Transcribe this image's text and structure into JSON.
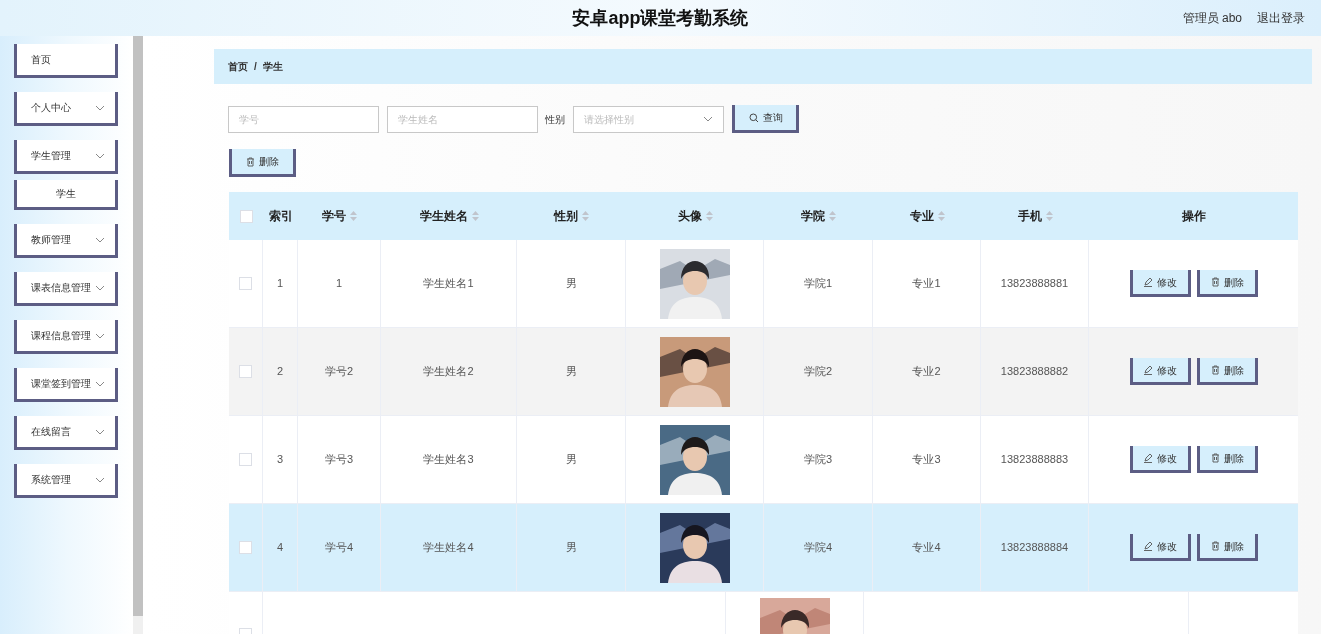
{
  "header": {
    "title": "安卓app课堂考勤系统",
    "user": "管理员 abo",
    "logout": "退出登录"
  },
  "sidebar": {
    "items": [
      {
        "label": "首页",
        "kind": "link"
      },
      {
        "label": "个人中心",
        "kind": "group"
      },
      {
        "label": "学生管理",
        "kind": "group",
        "children": [
          {
            "label": "学生"
          }
        ]
      },
      {
        "label": "教师管理",
        "kind": "group"
      },
      {
        "label": "课表信息管理",
        "kind": "group"
      },
      {
        "label": "课程信息管理",
        "kind": "group"
      },
      {
        "label": "课堂签到管理",
        "kind": "group"
      },
      {
        "label": "在线留言",
        "kind": "group"
      },
      {
        "label": "系统管理",
        "kind": "group"
      }
    ]
  },
  "breadcrumb": [
    "首页",
    "/",
    "学生"
  ],
  "search": {
    "student_no": {
      "placeholder": "学号"
    },
    "student_name": {
      "placeholder": "学生姓名"
    },
    "gender_label": "性别",
    "gender": {
      "placeholder": "请选择性别"
    },
    "query_button": "查询"
  },
  "delete_button": "删除",
  "table": {
    "select_all": {
      "checked": false
    },
    "columns": [
      {
        "label": "索引",
        "sortable": false
      },
      {
        "label": "学号",
        "sortable": true
      },
      {
        "label": "学生姓名",
        "sortable": true
      },
      {
        "label": "性别",
        "sortable": true
      },
      {
        "label": "头像",
        "sortable": true
      },
      {
        "label": "学院",
        "sortable": true
      },
      {
        "label": "专业",
        "sortable": true
      },
      {
        "label": "手机",
        "sortable": true
      },
      {
        "label": "操作",
        "sortable": false
      }
    ],
    "rows": [
      {
        "checked": false,
        "hovered": false,
        "selected": false,
        "cells": [
          "1",
          "1",
          "学生姓名1",
          "男",
          "",
          "学院1",
          "专业1",
          "13823888881"
        ],
        "actions": [
          "修改",
          "删除"
        ]
      },
      {
        "checked": false,
        "hovered": true,
        "selected": false,
        "cells": [
          "2",
          "学号2",
          "学生姓名2",
          "男",
          "",
          "学院2",
          "专业2",
          "13823888882"
        ],
        "actions": [
          "修改",
          "删除"
        ]
      },
      {
        "checked": false,
        "hovered": false,
        "selected": false,
        "cells": [
          "3",
          "学号3",
          "学生姓名3",
          "男",
          "",
          "学院3",
          "专业3",
          "13823888883"
        ],
        "actions": [
          "修改",
          "删除"
        ]
      },
      {
        "checked": false,
        "hovered": false,
        "selected": true,
        "cells": [
          "4",
          "学号4",
          "学生姓名4",
          "男",
          "",
          "学院4",
          "专业4",
          "13823888884"
        ],
        "actions": [
          "修改",
          "删除"
        ]
      }
    ],
    "partial_row": {
      "checked": false
    }
  }
}
